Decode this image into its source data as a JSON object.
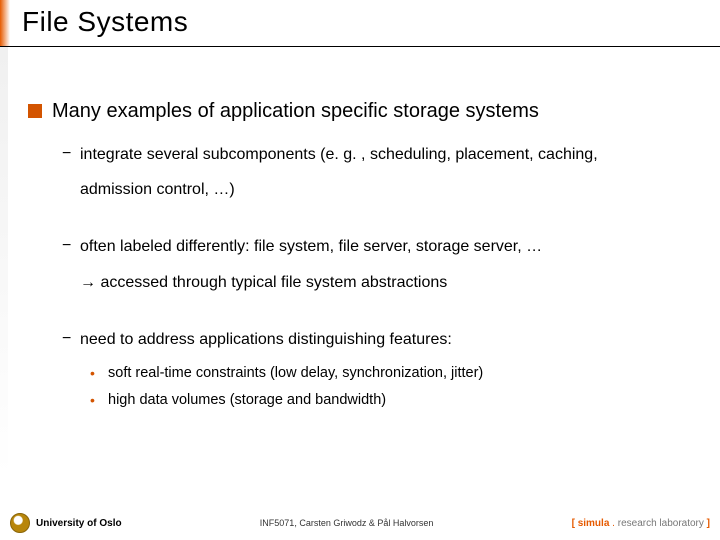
{
  "title": "File Systems",
  "main": {
    "point": "Many examples of application specific storage systems",
    "sub1_line1": "integrate several subcomponents (e. g. , scheduling, placement, caching,",
    "sub1_line2": "admission control, …)",
    "sub2_line1": "often labeled differently: file system, file server, storage server, …",
    "sub2_line2": "→ accessed through typical file system abstractions",
    "sub3": "need to address applications distinguishing features:",
    "sub3a": "soft real-time constraints (low delay, synchronization, jitter)",
    "sub3b": "high data volumes (storage and bandwidth)"
  },
  "footer": {
    "university": "University of Oslo",
    "course": "INF5071, Carsten Griwodz & Pål Halvorsen",
    "lab_bracket_open": "[ ",
    "lab_name": "simula",
    "lab_dot": " . ",
    "lab_suffix": "research laboratory",
    "lab_bracket_close": " ]"
  }
}
